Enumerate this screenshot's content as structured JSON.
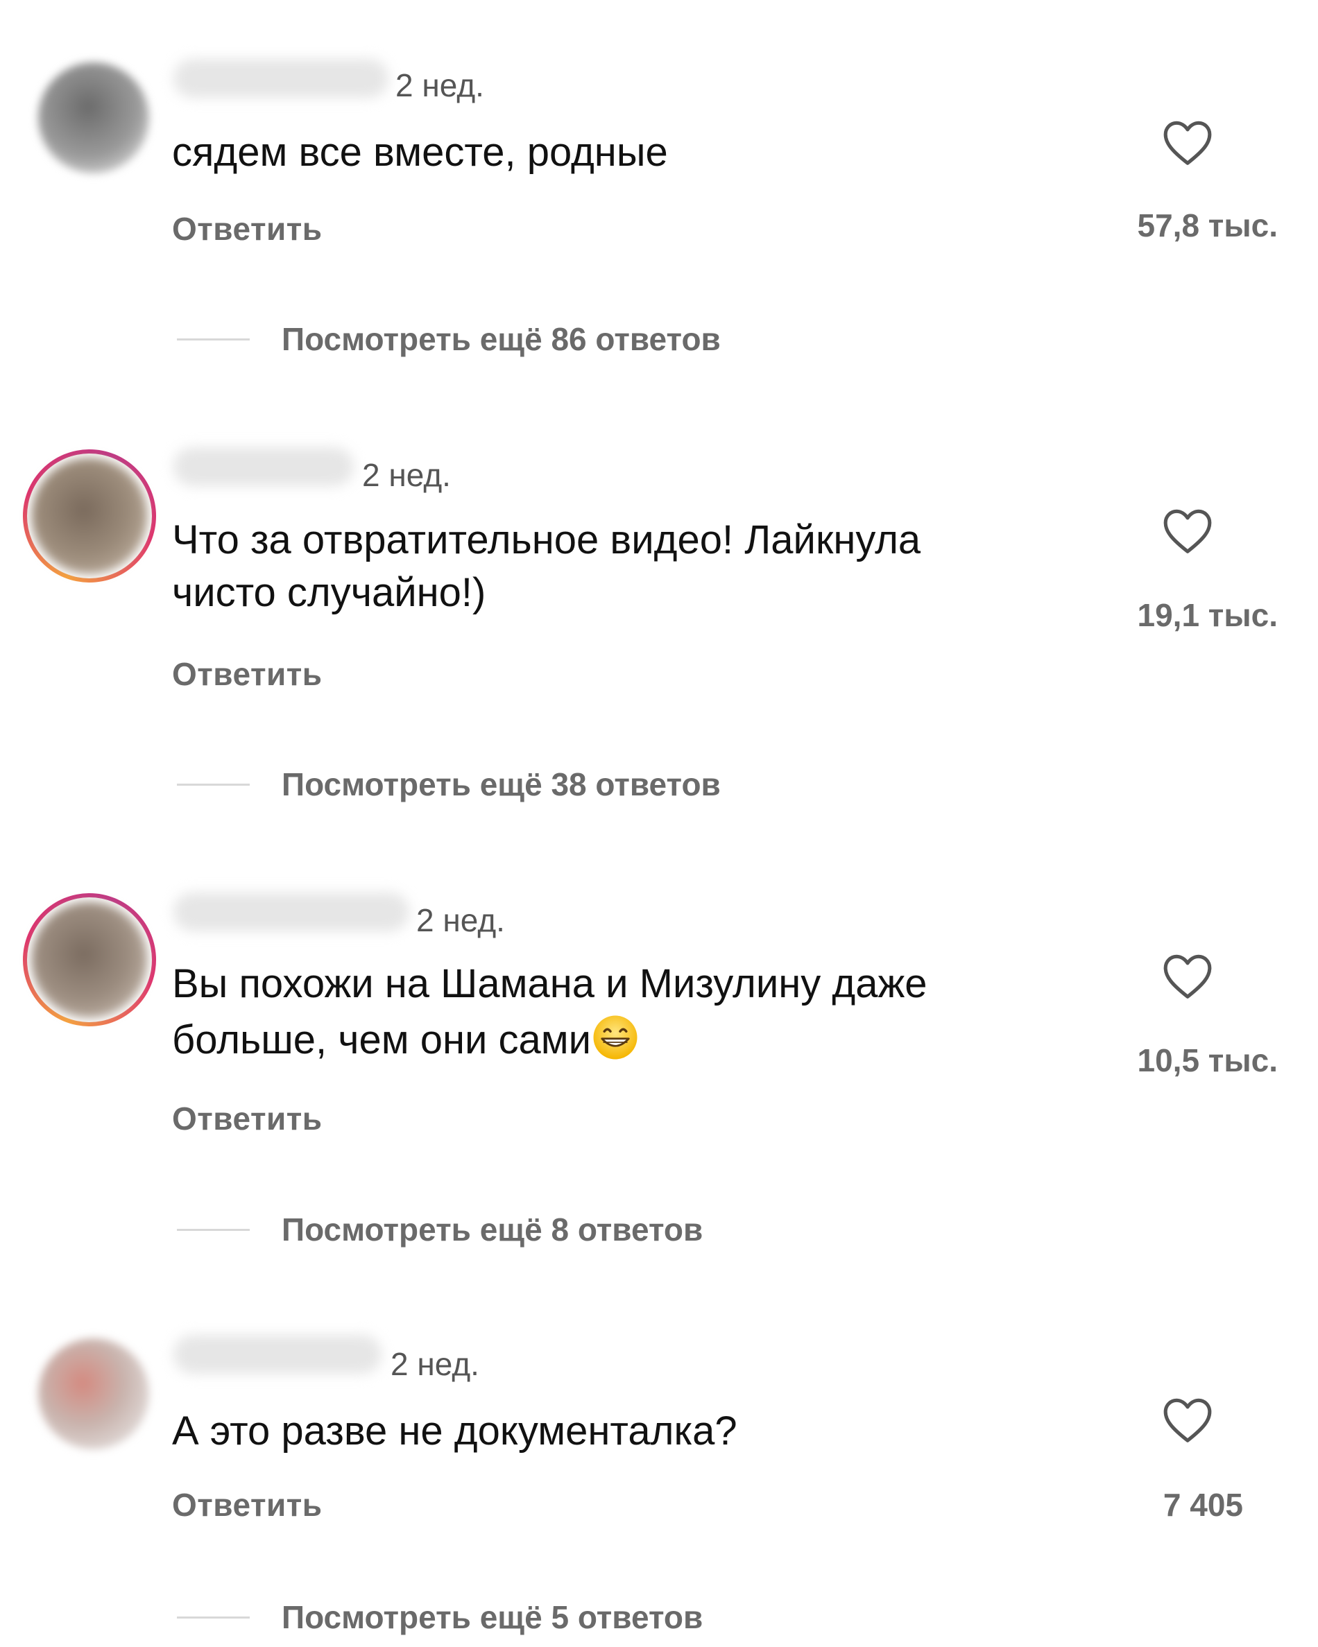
{
  "comments": [
    {
      "time": "2 нед.",
      "text": "сядем все вместе, родные",
      "reply_label": "Ответить",
      "likes": "57,8 тыс.",
      "more_replies": "Посмотреть ещё 86 ответов",
      "avatar_story_ring": false
    },
    {
      "time": "2 нед.",
      "text_line1": "Что за отвратительное видео! Лайкнула",
      "text_line2": "чисто случайно!)",
      "reply_label": "Ответить",
      "likes": "19,1 тыс.",
      "more_replies": "Посмотреть ещё 38 ответов",
      "avatar_story_ring": true
    },
    {
      "time": "2 нед.",
      "text_line1": "Вы похожи на Шамана и Мизулину даже",
      "text_line2": "больше, чем они сами",
      "emoji": "grinning-face-with-smiling-eyes",
      "reply_label": "Ответить",
      "likes": "10,5 тыс.",
      "more_replies": "Посмотреть ещё 8 ответов",
      "avatar_story_ring": true
    },
    {
      "time": "2 нед.",
      "text": "А это разве не документалка?",
      "reply_label": "Ответить",
      "likes": "7 405",
      "more_replies": "Посмотреть ещё 5 ответов",
      "avatar_story_ring": false
    }
  ],
  "colors": {
    "text": "#111111",
    "meta": "#6a6a6a",
    "ring_start": "#f9a13a",
    "ring_end": "#c13584"
  }
}
